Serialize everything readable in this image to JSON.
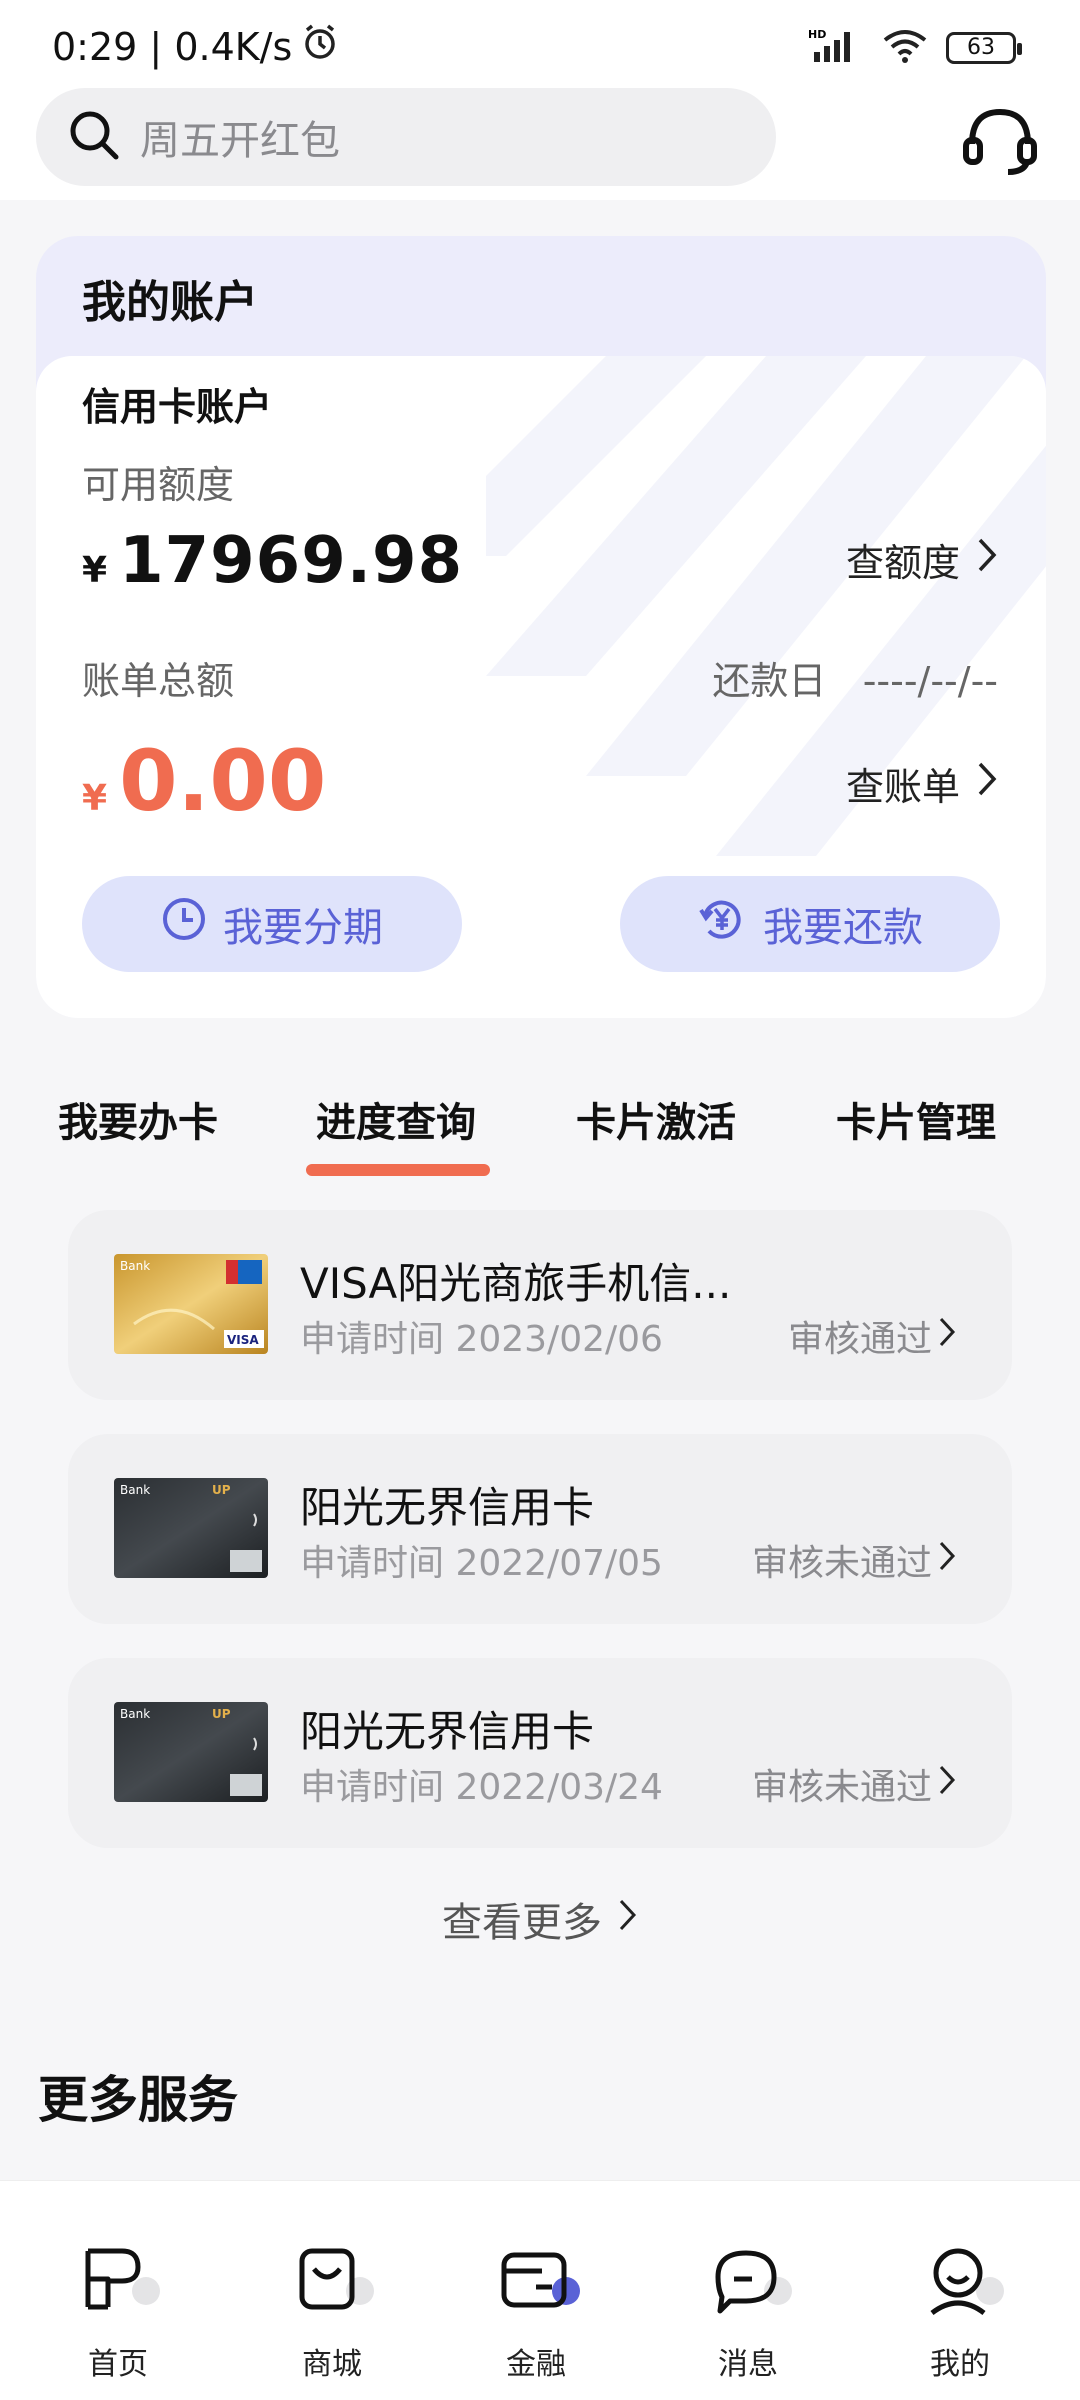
{
  "status_bar": {
    "time": "0:29",
    "speed": "0.4K/s",
    "signal_label": "HD",
    "battery": "63"
  },
  "search": {
    "placeholder": "周五开红包"
  },
  "account": {
    "title": "我的账户",
    "card_title": "信用卡账户",
    "available_label": "可用额度",
    "currency": "¥",
    "available_value": "17969.98",
    "check_limit": "查额度",
    "bill_label": "账单总额",
    "repay_label": "还款日",
    "repay_date": "----/--/--",
    "bill_value": "0.00",
    "check_bill": "查账单",
    "installment": "我要分期",
    "repay": "我要还款"
  },
  "tabs": [
    {
      "label": "我要办卡"
    },
    {
      "label": "进度查询",
      "active": true
    },
    {
      "label": "卡片激活"
    },
    {
      "label": "卡片管理"
    }
  ],
  "applications": [
    {
      "name": "VISA阳光商旅手机信...",
      "date": "申请时间 2023/02/06",
      "status": "审核通过",
      "card_style": "gold-visa"
    },
    {
      "name": "阳光无界信用卡",
      "date": "申请时间 2022/07/05",
      "status": "审核未通过",
      "card_style": "black-up"
    },
    {
      "name": "阳光无界信用卡",
      "date": "申请时间 2022/03/24",
      "status": "审核未通过",
      "card_style": "black-up"
    }
  ],
  "view_more": "查看更多",
  "more_services": "更多服务",
  "bottom_nav": [
    {
      "label": "首页",
      "icon": "home-icon"
    },
    {
      "label": "商城",
      "icon": "mall-icon"
    },
    {
      "label": "金融",
      "icon": "finance-icon",
      "active": true
    },
    {
      "label": "消息",
      "icon": "message-icon"
    },
    {
      "label": "我的",
      "icon": "profile-icon"
    }
  ],
  "colors": {
    "accent": "#f06c50",
    "primary": "#5a62d6",
    "pill_bg": "#dfe3fb"
  }
}
